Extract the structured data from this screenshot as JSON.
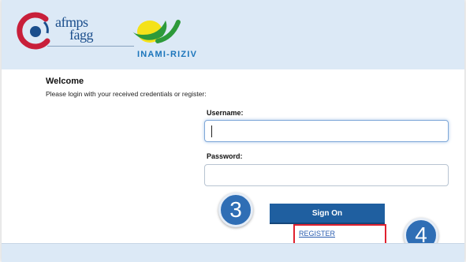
{
  "header": {
    "afmps_line1": "afmps",
    "afmps_line2": "fagg",
    "inami_label": "INAMI-RIZIV"
  },
  "login": {
    "welcome": "Welcome",
    "intro": "Please login with your received credentials or register:",
    "username_label": "Username:",
    "username_value": "",
    "password_label": "Password:",
    "password_value": "",
    "sign_on": "Sign On",
    "register": "REGISTER"
  },
  "annotations": {
    "step3": "3",
    "step4": "4",
    "highlight_color": "#e0212f",
    "badge_color": "#2f6eb5"
  },
  "colors": {
    "header_bg": "#dce9f6",
    "button_bg": "#1f5fa0"
  }
}
